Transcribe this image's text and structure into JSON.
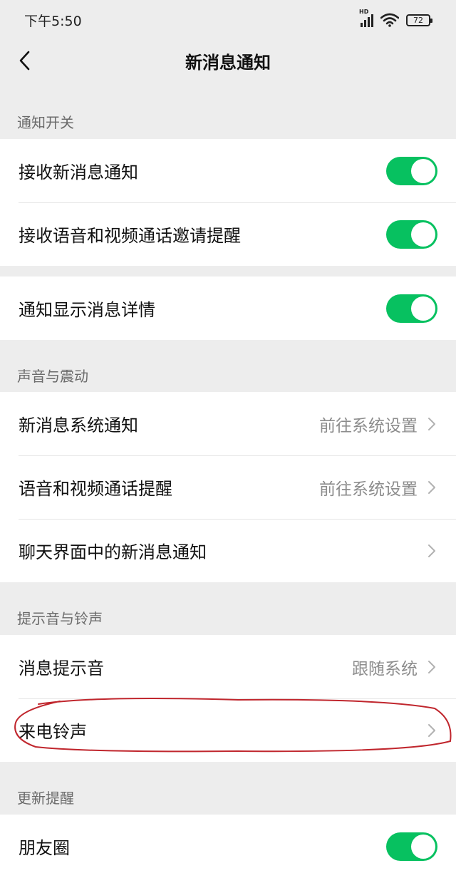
{
  "status_bar": {
    "time": "下午5:50",
    "network": "HD",
    "battery": "72",
    "icons": [
      "signal-icon",
      "wifi-icon",
      "battery-icon"
    ]
  },
  "nav": {
    "title": "新消息通知",
    "back_icon": "chevron-left-icon"
  },
  "sections": {
    "notify_switch": {
      "title": "通知开关",
      "items": [
        {
          "label": "接收新消息通知",
          "toggle": true
        },
        {
          "label": "接收语音和视频通话邀请提醒",
          "toggle": true
        }
      ]
    },
    "notify_detail": {
      "items": [
        {
          "label": "通知显示消息详情",
          "toggle": true
        }
      ]
    },
    "sound_vibration": {
      "title": "声音与震动",
      "items": [
        {
          "label": "新消息系统通知",
          "value": "前往系统设置"
        },
        {
          "label": "语音和视频通话提醒",
          "value": "前往系统设置"
        },
        {
          "label": "聊天界面中的新消息通知",
          "value": ""
        }
      ]
    },
    "tones": {
      "title": "提示音与铃声",
      "items": [
        {
          "label": "消息提示音",
          "value": "跟随系统"
        },
        {
          "label": "来电铃声",
          "value": ""
        }
      ]
    },
    "update_reminder": {
      "title": "更新提醒",
      "items": [
        {
          "label": "朋友圈",
          "toggle": true
        }
      ]
    }
  },
  "colors": {
    "accent": "#07c160",
    "background": "#ededed",
    "annotation": "#c0262d"
  }
}
